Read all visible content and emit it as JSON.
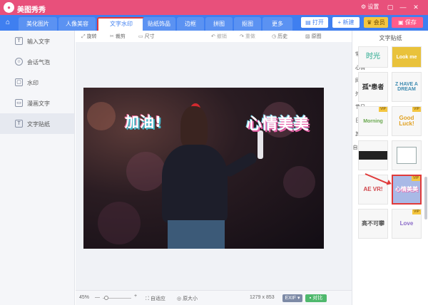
{
  "app": {
    "title": "美图秀秀",
    "settings_label": "设置"
  },
  "nav": {
    "tabs": [
      {
        "label": "美化图片"
      },
      {
        "label": "人像美容"
      },
      {
        "label": "文字水印"
      },
      {
        "label": "贴纸饰品"
      },
      {
        "label": "边框"
      },
      {
        "label": "拼图"
      },
      {
        "label": "抠图"
      },
      {
        "label": "更多"
      }
    ],
    "actions": {
      "open": "打开",
      "new": "新建",
      "vip": "会员",
      "save": "保存"
    }
  },
  "sidebar": {
    "items": [
      {
        "label": "输入文字",
        "icon": "T"
      },
      {
        "label": "会话气泡",
        "icon": "○"
      },
      {
        "label": "水印",
        "icon": "▢"
      },
      {
        "label": "漫画文字",
        "icon": "▭"
      },
      {
        "label": "文字贴纸",
        "icon": "T"
      }
    ],
    "active": "文字贴纸"
  },
  "toolbar": {
    "rotate": "旋转",
    "crop": "裁剪",
    "size": "尺寸",
    "undo": "撤销",
    "redo": "重做",
    "history": "历史",
    "original": "原图"
  },
  "canvas": {
    "stickers": [
      {
        "text": "加油!"
      },
      {
        "text": "心情美美"
      }
    ]
  },
  "status": {
    "zoom": "45%",
    "fit": "自适应",
    "actual": "原大小",
    "dimensions": "1279 x 853",
    "exif": "EXIF",
    "compare": "对比"
  },
  "right_panel": {
    "title": "文字贴纸",
    "categories": [
      "常用",
      "心情",
      "网络",
      "外文",
      "节日",
      "日历",
      "其他",
      "自定义"
    ],
    "thumbs": [
      {
        "text": "时光"
      },
      {
        "text": "Look me"
      },
      {
        "text": "孤*患者"
      },
      {
        "text": "Z HAVE A DREAM"
      },
      {
        "text": "Morning"
      },
      {
        "text": "Good Luck!"
      },
      {
        "text": ""
      },
      {
        "text": ""
      },
      {
        "text": "AE VR!"
      },
      {
        "text": "心情美美"
      },
      {
        "text": "高不可攀"
      },
      {
        "text": "Love"
      }
    ],
    "vip_label": "VIP"
  }
}
